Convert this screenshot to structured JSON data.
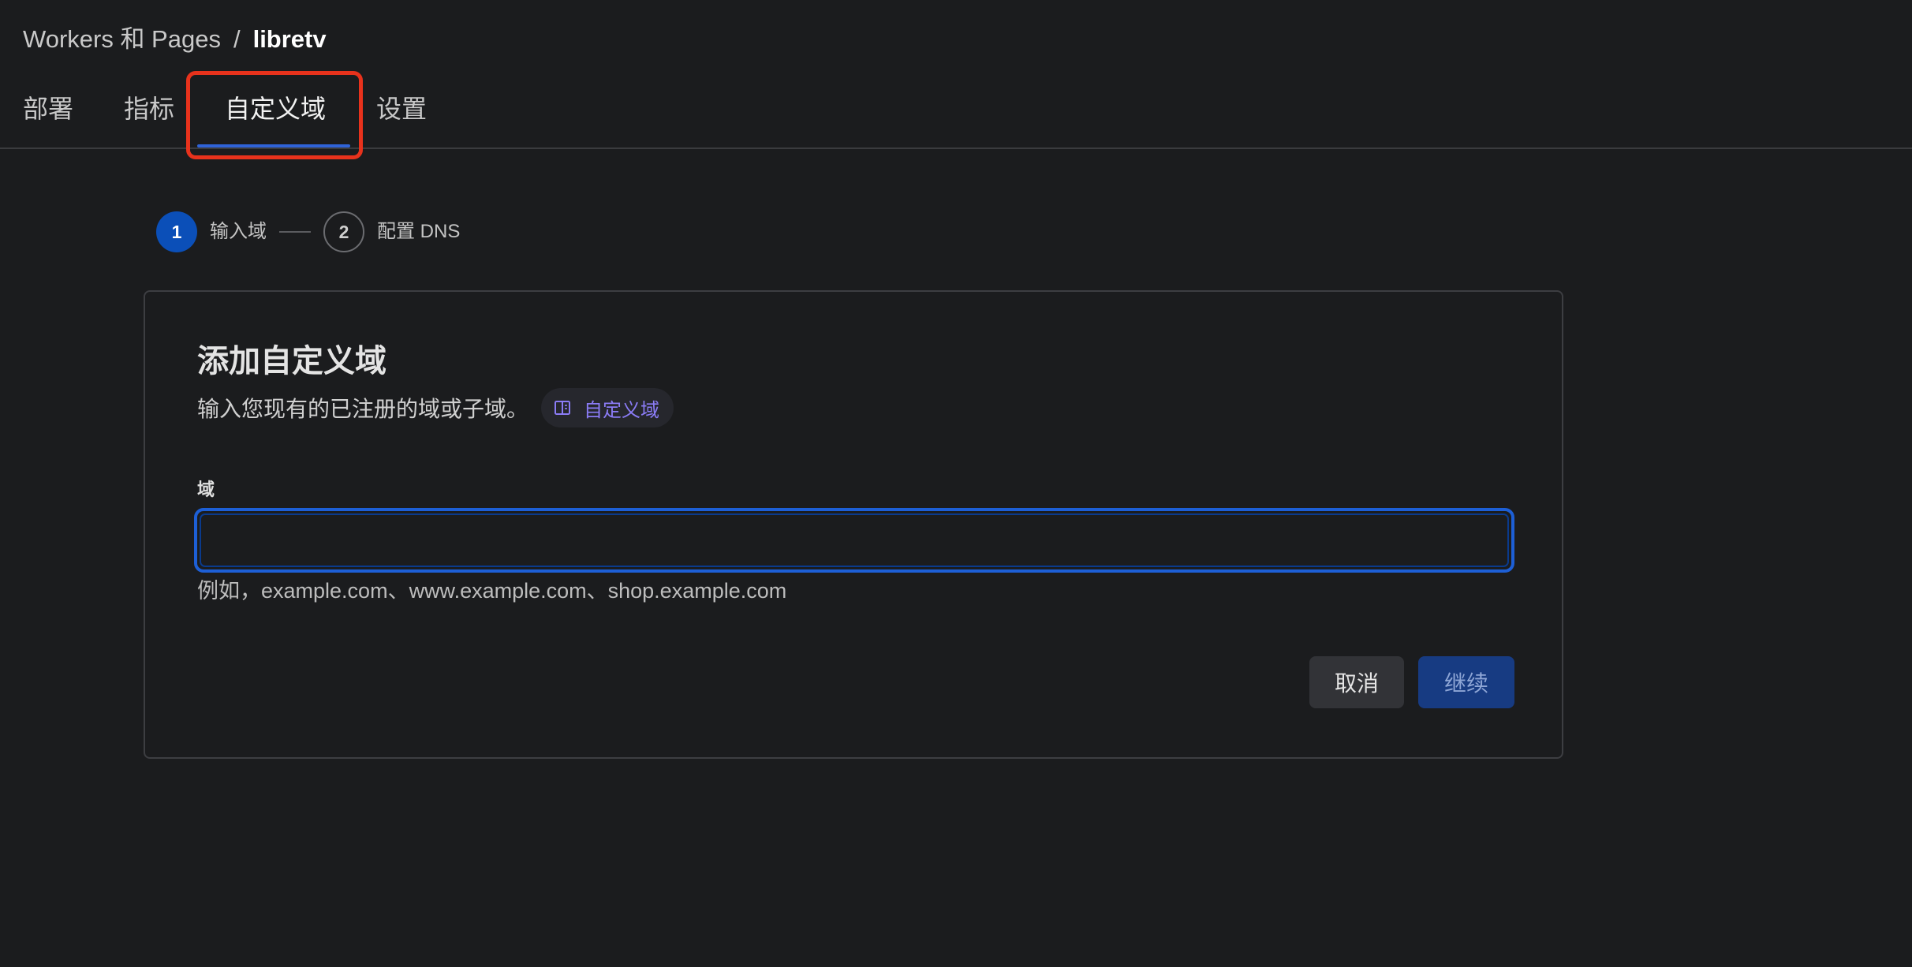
{
  "breadcrumb": {
    "parent": "Workers 和 Pages",
    "separator": "/",
    "current": "libretv"
  },
  "tabs": [
    {
      "label": "部署"
    },
    {
      "label": "指标"
    },
    {
      "label": "自定义域",
      "active": true
    },
    {
      "label": "设置"
    }
  ],
  "stepper": {
    "steps": [
      {
        "number": "1",
        "label": "输入域",
        "active": true
      },
      {
        "number": "2",
        "label": "配置 DNS",
        "active": false
      }
    ]
  },
  "card": {
    "title": "添加自定义域",
    "description": "输入您现有的已注册的域或子域。",
    "doc_link": {
      "label": "自定义域",
      "icon": "book-icon"
    },
    "field": {
      "label": "域",
      "value": "",
      "placeholder": "",
      "hint": "例如，example.com、www.example.com、shop.example.com"
    },
    "buttons": {
      "cancel": "取消",
      "continue": "继续"
    }
  },
  "colors": {
    "background": "#1b1c1e",
    "accent": "#0b4fb8",
    "link": "#8b7cf6",
    "highlight": "#e8321c"
  }
}
